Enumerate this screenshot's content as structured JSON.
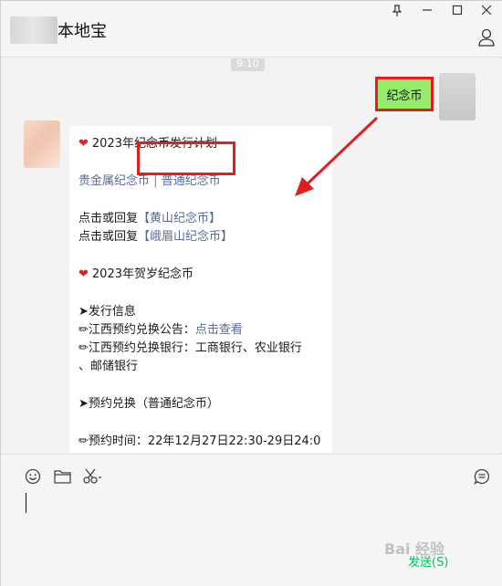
{
  "header": {
    "title": "本地宝",
    "controls": [
      "⊥",
      "—",
      "☐",
      "✕"
    ]
  },
  "chat": {
    "time": "9:10",
    "sent_message": "纪念币",
    "reply": {
      "line1": "2023年纪念币发行计划",
      "link_precious": "贵金属纪念币",
      "sep": "|",
      "link_normal": "普通纪念币",
      "reply_prefix1": "点击或回复",
      "reply_kw1": "【黄山纪念币】",
      "reply_prefix2": "点击或回复",
      "reply_kw2": "【峨眉山纪念币】",
      "line_hesui": "2023年贺岁纪念币",
      "issue_info": "➤发行信息",
      "notice_prefix": "✏江西预约兑换公告：",
      "notice_link": "点击查看",
      "banks_line1": "✏江西预约兑换银行：工商银行、农业银行",
      "banks_line2": "、邮储银行",
      "reserve_title": "➤预约兑换（普通纪念币）",
      "reserve_time": "✏预约时间：22年12月27日22:30-29日24:0"
    }
  },
  "input": {
    "send_label": "发送(S)",
    "watermark": "Bai 经验"
  },
  "colors": {
    "bubble_green": "#95ec69",
    "highlight_red": "#e02020",
    "link_blue": "#576b95"
  }
}
